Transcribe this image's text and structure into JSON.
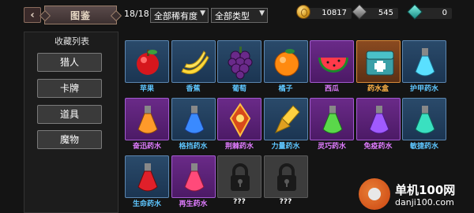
{
  "header": {
    "back_icon": "chevron-left-icon",
    "title": "图鉴",
    "count": "18/18",
    "filter_rarity": "全部稀有度",
    "filter_type": "全部类型"
  },
  "currencies": [
    {
      "icon": "gold-coin-icon",
      "value": "10817"
    },
    {
      "icon": "gray-gem-icon",
      "value": "545"
    },
    {
      "icon": "teal-gem-icon",
      "value": "0"
    }
  ],
  "sidebar": {
    "title": "收藏列表",
    "items": [
      {
        "label": "猎人"
      },
      {
        "label": "卡牌"
      },
      {
        "label": "道具"
      },
      {
        "label": "魔物"
      }
    ]
  },
  "colors": {
    "rarity_blue": "#5ec6ff",
    "rarity_purple": "#e07cff",
    "rarity_orange": "#ffb347"
  },
  "items": [
    {
      "name": "苹果",
      "icon": "apple-icon",
      "rarity": "blue"
    },
    {
      "name": "香蕉",
      "icon": "banana-icon",
      "rarity": "blue"
    },
    {
      "name": "葡萄",
      "icon": "grapes-icon",
      "rarity": "blue"
    },
    {
      "name": "橘子",
      "icon": "orange-icon",
      "rarity": "blue"
    },
    {
      "name": "西瓜",
      "icon": "watermelon-icon",
      "rarity": "purple"
    },
    {
      "name": "药水盒",
      "icon": "medkit-chest-icon",
      "rarity": "orange"
    },
    {
      "name": "护甲药水",
      "icon": "cyan-potion-icon",
      "rarity": "blue"
    },
    {
      "name": "奋迅药水",
      "icon": "orange-potion-icon",
      "rarity": "purple"
    },
    {
      "name": "格挡药水",
      "icon": "blue-potion-icon",
      "rarity": "blue"
    },
    {
      "name": "荆棘药水",
      "icon": "thorn-amulet-icon",
      "rarity": "purple"
    },
    {
      "name": "力量药水",
      "icon": "gold-potion-icon",
      "rarity": "blue"
    },
    {
      "name": "灵巧药水",
      "icon": "green-potion-icon",
      "rarity": "purple"
    },
    {
      "name": "免疫药水",
      "icon": "violet-potion-icon",
      "rarity": "purple"
    },
    {
      "name": "敏捷药水",
      "icon": "teal-potion-icon",
      "rarity": "blue"
    },
    {
      "name": "生命药水",
      "icon": "red-potion-icon",
      "rarity": "blue"
    },
    {
      "name": "再生药水",
      "icon": "pink-potion-icon",
      "rarity": "purple"
    },
    {
      "name": "???",
      "icon": "lock-icon",
      "rarity": "locked"
    },
    {
      "name": "???",
      "icon": "lock-icon",
      "rarity": "locked"
    }
  ],
  "watermark": {
    "site_name": "单机100网",
    "url": "danji100.com"
  }
}
